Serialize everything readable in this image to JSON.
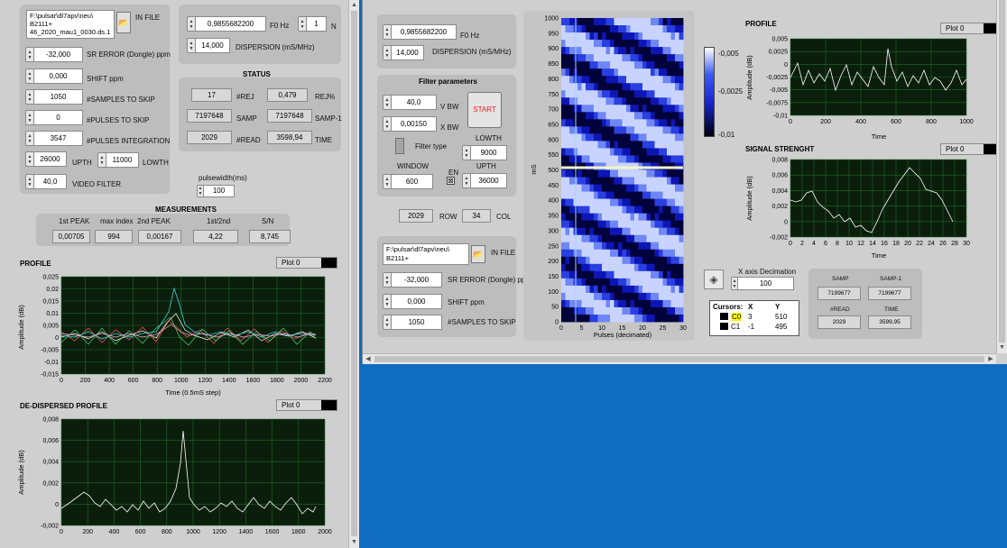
{
  "left": {
    "in_file": {
      "path": "F:\\pulsar\\dl7apv\\neu\\ B2111+ 46_2020_mau1_0030.ds.1",
      "label": "IN FILE"
    },
    "sr_error": {
      "value": "-32,000",
      "label": "SR ERROR (Dongle) ppm"
    },
    "shift": {
      "value": "0,000",
      "label": "SHIFT ppm"
    },
    "samples_skip": {
      "value": "1050",
      "label": "#SAMPLES TO SKIP"
    },
    "pulses_skip": {
      "value": "0",
      "label": "#PULSES TO SKIP"
    },
    "pulses_integration": {
      "value": "3547",
      "label": "#PULSES INTEGRATION"
    },
    "upth": {
      "value": "26000",
      "label": "UPTH"
    },
    "lowth": {
      "value": "11000",
      "label": "LOWTH"
    },
    "video_filter": {
      "value": "40,0",
      "label": "VIDEO FILTER"
    },
    "f0": {
      "value": "0,9855682200",
      "label": "F0 Hz"
    },
    "n": {
      "value": "1",
      "label": "N"
    },
    "dispersion": {
      "value": "14,000",
      "label": "DISPERSION (mS/MHz)"
    },
    "status_title": "STATUS",
    "status": {
      "rej": "17",
      "rej_label": "#REJ",
      "rej_pct": "0,479",
      "rej_pct_label": "REJ%",
      "samp": "7197648",
      "samp_label": "SAMP",
      "samp1": "7197648",
      "samp1_label": "SAMP-1",
      "read": "2029",
      "read_label": "#READ",
      "time": "3598,94",
      "time_label": "TIME"
    },
    "pulsewidth": {
      "label": "pulsewidth(ms)",
      "value": "100"
    },
    "measurements": {
      "title": "MEASUREMENTS",
      "h1": "1st PEAK",
      "h2": "max index",
      "h3": "2nd PEAK",
      "h4": "1st/2nd",
      "h5": "S/N",
      "v1": "0,00705",
      "v2": "994",
      "v3": "0,00167",
      "v4": "4,22",
      "v5": "8,745"
    },
    "profile": {
      "title": "PROFILE",
      "legend": "Plot 0",
      "ylabel": "Amplitude (dB)",
      "xlabel": "Time (0.5mS step)",
      "yticks": [
        "0,025",
        "0,02",
        "0,015",
        "0,01",
        "0,005",
        "0",
        "-0,005",
        "-0,01",
        "-0,015"
      ],
      "xticks": [
        "0",
        "200",
        "400",
        "600",
        "800",
        "1000",
        "1200",
        "1400",
        "1600",
        "1800",
        "2000",
        "2200"
      ]
    },
    "dedispersed": {
      "title": "DE-DISPERSED PROFILE",
      "legend": "Plot 0",
      "ylabel": "Amplitude (dB)",
      "yticks": [
        "0,008",
        "0,006",
        "0,004",
        "0,002",
        "0",
        "-0,002"
      ],
      "xticks": [
        "0",
        "200",
        "400",
        "600",
        "800",
        "1000",
        "1200",
        "1400",
        "1600",
        "1800",
        "2000"
      ]
    }
  },
  "right": {
    "f0": {
      "value": "0,9855682200",
      "label": "F0 Hz"
    },
    "dispersion": {
      "value": "14,000",
      "label": "DISPERSION (mS/MHz)"
    },
    "filter": {
      "title": "Filter parameters",
      "vbw": "40,0",
      "vbw_label": "V BW",
      "xbw": "0,00150",
      "xbw_label": "X BW",
      "start": "START",
      "filter_type": "Filter type",
      "lowth_label": "LOWTH",
      "lowth": "9000",
      "upth_label": "UPTH",
      "upth": "36000",
      "window_label": "WINDOW",
      "window": "600",
      "en": "EN"
    },
    "row": {
      "value": "2029",
      "label": "ROW"
    },
    "col": {
      "value": "34",
      "label": "COL"
    },
    "in_file": {
      "path": "F:\\pulsar\\dl7apv\\neu\\ B2111+",
      "label": "IN FILE"
    },
    "sr_error": {
      "value": "-32,000",
      "label": "SR ERROR (Dongle) ppm"
    },
    "shift": {
      "value": "0,000",
      "label": "SHIFT ppm"
    },
    "samples_skip": {
      "value": "1050",
      "label": "#SAMPLES TO SKIP"
    },
    "waterfall": {
      "ylabel": "mS",
      "xlabel": "Pulses (decimated)",
      "yticks": [
        "1000",
        "950",
        "900",
        "850",
        "800",
        "750",
        "700",
        "650",
        "600",
        "550",
        "500",
        "450",
        "400",
        "350",
        "300",
        "250",
        "200",
        "150",
        "100",
        "50",
        "0"
      ],
      "xticks": [
        "0",
        "5",
        "10",
        "15",
        "20",
        "25",
        "30"
      ],
      "scale": [
        "-0,005",
        "-0,0025",
        "-0,01"
      ]
    },
    "profile": {
      "title": "PROFILE",
      "legend": "Plot 0",
      "ylabel": "Amplitude (dB)",
      "xlabel": "Time",
      "yticks": [
        "0,005",
        "0,0025",
        "0",
        "-0,0025",
        "-0,005",
        "-0,0075",
        "-0,01"
      ],
      "xticks": [
        "0",
        "200",
        "400",
        "600",
        "800",
        "1000"
      ]
    },
    "signal": {
      "title": "SIGNAL STRENGHT",
      "legend": "Plot 0",
      "ylabel": "Amplitude (dB)",
      "xlabel": "Time",
      "yticks": [
        "0,008",
        "0,006",
        "0,004",
        "0,002",
        "0",
        "-0,002"
      ],
      "xticks": [
        "0",
        "2",
        "4",
        "6",
        "8",
        "10",
        "12",
        "14",
        "16",
        "18",
        "20",
        "22",
        "24",
        "26",
        "28",
        "30"
      ]
    },
    "xdecim": {
      "label": "X axis Decimation",
      "value": "100"
    },
    "cursors": {
      "title": "Cursors:",
      "x": "X",
      "y": "Y",
      "c0": "C0",
      "c0x": "3",
      "c0y": "510",
      "c1": "C1",
      "c1x": "-1",
      "c1y": "495"
    },
    "stat": {
      "samp_label": "SAMP",
      "samp": "7199677",
      "samp1_label": "SAMP-1",
      "samp1": "7199677",
      "read_label": "#READ",
      "read": "2029",
      "time_label": "TIME",
      "time": "3599,95"
    }
  }
}
